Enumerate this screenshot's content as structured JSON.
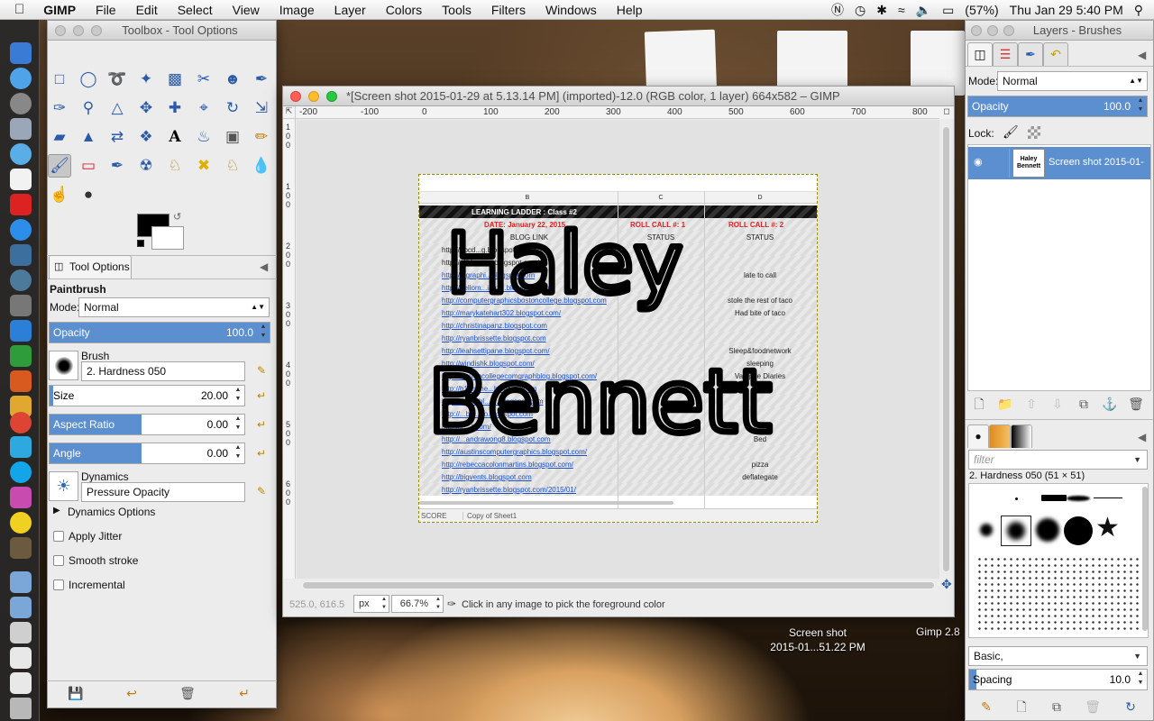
{
  "menubar": {
    "apple": "",
    "app": "GIMP",
    "menus": [
      "File",
      "Edit",
      "Select",
      "View",
      "Image",
      "Layer",
      "Colors",
      "Tools",
      "Filters",
      "Windows",
      "Help"
    ],
    "battery": "(57%)",
    "datetime": "Thu Jan 29  5:40 PM"
  },
  "toolbox": {
    "title": "Toolbox - Tool Options",
    "tab_label": "Tool Options",
    "tool_name": "Paintbrush",
    "mode_label": "Mode:",
    "mode_value": "Normal",
    "opacity_label": "Opacity",
    "opacity_value": "100.0",
    "opacity_fraction": 1.0,
    "brush_label": "Brush",
    "brush_value": "2. Hardness 050",
    "size_label": "Size",
    "size_value": "20.00",
    "aspect_label": "Aspect Ratio",
    "aspect_value": "0.00",
    "angle_label": "Angle",
    "angle_value": "0.00",
    "dynamics_label": "Dynamics",
    "dynamics_value": "Pressure Opacity",
    "dynamics_options": "Dynamics Options",
    "apply_jitter": "Apply Jitter",
    "smooth_stroke": "Smooth stroke",
    "incremental": "Incremental"
  },
  "image_window": {
    "title": "*[Screen shot 2015-01-29 at 5.13.14 PM] (imported)-12.0 (RGB color, 1 layer) 664x582 – GIMP",
    "ruler_h": [
      "-200",
      "-100",
      "0",
      "100",
      "200",
      "300",
      "400",
      "500",
      "600",
      "700",
      "800"
    ],
    "ruler_v": [
      "1",
      "0",
      "0",
      "1",
      "0",
      "0",
      "2",
      "0",
      "0",
      "3",
      "0",
      "0",
      "4",
      "0",
      "0",
      "5",
      "0",
      "0",
      "6",
      "0",
      "0"
    ],
    "coords": "525.0, 616.5",
    "unit": "px",
    "zoom": "66.7%",
    "status_msg": "Click in any image to pick the foreground color"
  },
  "sheet": {
    "col_b": "B",
    "col_c": "C",
    "col_d": "D",
    "banner": "LEARNING LADDER : Class #2",
    "date": "DATE: January 22, 2015",
    "roll1": "ROLL CALL #: 1",
    "roll2": "ROLL CALL #: 2",
    "blog_link": "BLOG LINK",
    "status1": "STATUS",
    "status2": "STATUS",
    "rows": [
      {
        "link": "http://abcd...g.blogspot.com/",
        "plain": true,
        "c": "",
        "d": ""
      },
      {
        "link": "http://hijklm...op.blogspot.com/",
        "plain": true,
        "c": "",
        "d": ""
      },
      {
        "link": "http://...graphi...blogspot.com",
        "plain": false,
        "c": "",
        "d": "late to call"
      },
      {
        "link": "http://hellom...iami...blogspot.com",
        "plain": false,
        "c": "",
        "d": ""
      },
      {
        "link": "http://computergraphicsbostoncollege.blogspot.com",
        "plain": false,
        "c": "",
        "d": "stole the rest of taco"
      },
      {
        "link": "http://marykatehart302.blogspot.com/",
        "plain": false,
        "c": "",
        "d": "Had bite of taco"
      },
      {
        "link": "http://christinapanz.blogspot.com",
        "plain": false,
        "c": "",
        "d": ""
      },
      {
        "link": "http://ryanbrissette.blogspot.com",
        "plain": false,
        "c": "",
        "d": ""
      },
      {
        "link": "http://leahsettipane.blogspot.com/",
        "plain": false,
        "c": "",
        "d": "Sleep&foodnetwork"
      },
      {
        "link": "http://windishk.blogspot.com/",
        "plain": false,
        "c": "",
        "d": "sleeping"
      },
      {
        "link": "http://bostoncollegecomgraphblog.blogspot.com/",
        "plain": false,
        "c": "",
        "d": "Vampire Diaries"
      },
      {
        "link": "http://b1benne...blogspot.com",
        "plain": false,
        "c": "",
        "d": ""
      },
      {
        "link": "http://...dischl...2...blogspot.com",
        "plain": false,
        "c": "",
        "d": ""
      },
      {
        "link": "http://...bo...tto.blogspot.com",
        "plain": false,
        "c": "",
        "d": ""
      },
      {
        "link": "http://je...t.com/",
        "plain": false,
        "c": "",
        "d": ""
      },
      {
        "link": "http://...andrawong8.blogspot.com",
        "plain": false,
        "c": "",
        "d": "Bed"
      },
      {
        "link": "http://austinscomputergraphics.blogspot.com/",
        "plain": false,
        "c": "",
        "d": ""
      },
      {
        "link": "http://rebeccacolonmartins.blogspot.com/",
        "plain": false,
        "c": "",
        "d": "pizza"
      },
      {
        "link": "http://bigvents.blogspot.com",
        "plain": false,
        "c": "",
        "d": "deflategate"
      },
      {
        "link": "http://ryanbrissette.blogspot.com/2015/01/",
        "plain": false,
        "c": "",
        "d": ""
      }
    ],
    "tab1": "SCORE",
    "tab2": "Copy of Sheet1",
    "handwriting1": "Haley",
    "handwriting2": "Bennett"
  },
  "layers": {
    "title": "Layers - Brushes",
    "mode_label": "Mode:",
    "mode_value": "Normal",
    "opacity_label": "Opacity",
    "opacity_value": "100.0",
    "lock_label": "Lock:",
    "layer_name": "Screen shot 2015-01-",
    "thumb_text": "Haley Bennett"
  },
  "brushes": {
    "filter_placeholder": "filter",
    "brush_title": "2. Hardness 050 (51 × 51)",
    "preset": "Basic,",
    "spacing_label": "Spacing",
    "spacing_value": "10.0"
  },
  "desktop": {
    "file1_line1": "Screen shot",
    "file1_line2": "2015-01...51.22 PM",
    "file2": "Gimp 2.8"
  }
}
